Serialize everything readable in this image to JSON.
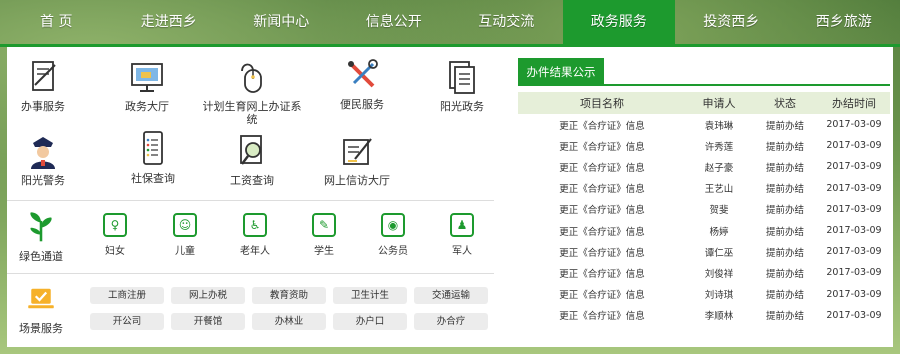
{
  "nav": {
    "items": [
      {
        "label": "首 页"
      },
      {
        "label": "走进西乡"
      },
      {
        "label": "新闻中心"
      },
      {
        "label": "信息公开"
      },
      {
        "label": "互动交流"
      },
      {
        "label": "政务服务"
      },
      {
        "label": "投资西乡"
      },
      {
        "label": "西乡旅游"
      }
    ],
    "active": "政务服务"
  },
  "services": [
    {
      "label": "办事服务",
      "icon": "document-pen-icon"
    },
    {
      "label": "政务大厅",
      "icon": "monitor-icon"
    },
    {
      "label": "计划生育网上办证系统",
      "icon": "mouse-icon"
    },
    {
      "label": "便民服务",
      "icon": "tools-icon"
    },
    {
      "label": "阳光政务",
      "icon": "documents-icon"
    },
    {
      "label": "阳光警务",
      "icon": "police-icon"
    },
    {
      "label": "社保查询",
      "icon": "phone-list-icon"
    },
    {
      "label": "工资查询",
      "icon": "magnifier-doc-icon"
    },
    {
      "label": "网上信访大厅",
      "icon": "letter-pen-icon"
    }
  ],
  "green_channel": {
    "label": "绿色通道",
    "icon": "seedling-icon",
    "items": [
      {
        "label": "妇女",
        "icon": "woman-icon"
      },
      {
        "label": "儿童",
        "icon": "child-icon"
      },
      {
        "label": "老年人",
        "icon": "wheelchair-icon"
      },
      {
        "label": "学生",
        "icon": "student-icon"
      },
      {
        "label": "公务员",
        "icon": "camera-icon"
      },
      {
        "label": "军人",
        "icon": "soldier-icon"
      }
    ]
  },
  "scene_service": {
    "label": "场景服务",
    "icon": "laptop-check-icon",
    "tags": [
      "工商注册",
      "网上办税",
      "教育资助",
      "卫生计生",
      "交通运输",
      "开公司",
      "开餐馆",
      "办林业",
      "办户口",
      "办合疗"
    ]
  },
  "results": {
    "title": "办件结果公示",
    "columns": [
      "项目名称",
      "申请人",
      "状态",
      "办结时间"
    ],
    "rows": [
      [
        "更正《合疗证》信息",
        "袁玮琳",
        "提前办结",
        "2017-03-09"
      ],
      [
        "更正《合疗证》信息",
        "许秀莲",
        "提前办结",
        "2017-03-09"
      ],
      [
        "更正《合疗证》信息",
        "赵子豪",
        "提前办结",
        "2017-03-09"
      ],
      [
        "更正《合疗证》信息",
        "王艺山",
        "提前办结",
        "2017-03-09"
      ],
      [
        "更正《合疗证》信息",
        "贺斐",
        "提前办结",
        "2017-03-09"
      ],
      [
        "更正《合疗证》信息",
        "杨婷",
        "提前办结",
        "2017-03-09"
      ],
      [
        "更正《合疗证》信息",
        "谭仁巫",
        "提前办结",
        "2017-03-09"
      ],
      [
        "更正《合疗证》信息",
        "刘俊祥",
        "提前办结",
        "2017-03-09"
      ],
      [
        "更正《合疗证》信息",
        "刘诗琪",
        "提前办结",
        "2017-03-09"
      ],
      [
        "更正《合疗证》信息",
        "李顺林",
        "提前办结",
        "2017-03-09"
      ]
    ]
  },
  "colors": {
    "accent": "#1d9a2e",
    "table_header_bg": "#e6efd9",
    "tag_bg": "#ececec"
  }
}
